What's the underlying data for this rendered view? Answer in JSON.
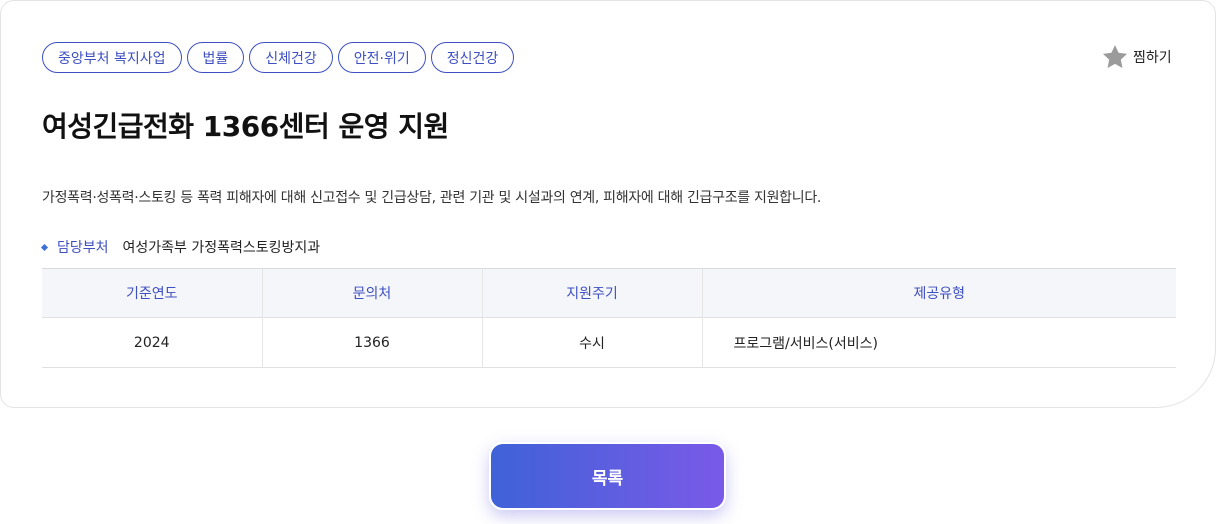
{
  "tags": [
    "중앙부처 복지사업",
    "법률",
    "신체건강",
    "안전·위기",
    "정신건강"
  ],
  "favorite": {
    "icon": "star-icon",
    "label": "찜하기",
    "icon_color": "#9b9b9b"
  },
  "title": "여성긴급전화 1366센터 운영 지원",
  "description": "가정폭력·성폭력·스토킹 등 폭력 피해자에 대해 신고접수 및 긴급상담, 관련 기관 및 시설과의 연계, 피해자에 대해 긴급구조를 지원합니다.",
  "department": {
    "label": "담당부처",
    "value": "여성가족부 가정폭력스토킹방지과"
  },
  "table": {
    "headers": [
      "기준연도",
      "문의처",
      "지원주기",
      "제공유형"
    ],
    "row": [
      "2024",
      "1366",
      "수시",
      "프로그램/서비스(서비스)"
    ]
  },
  "list_button": {
    "label": "목록"
  },
  "colors": {
    "accent": "#3d4fc2",
    "button_start": "#3f62d8",
    "button_end": "#7a5ae8"
  }
}
